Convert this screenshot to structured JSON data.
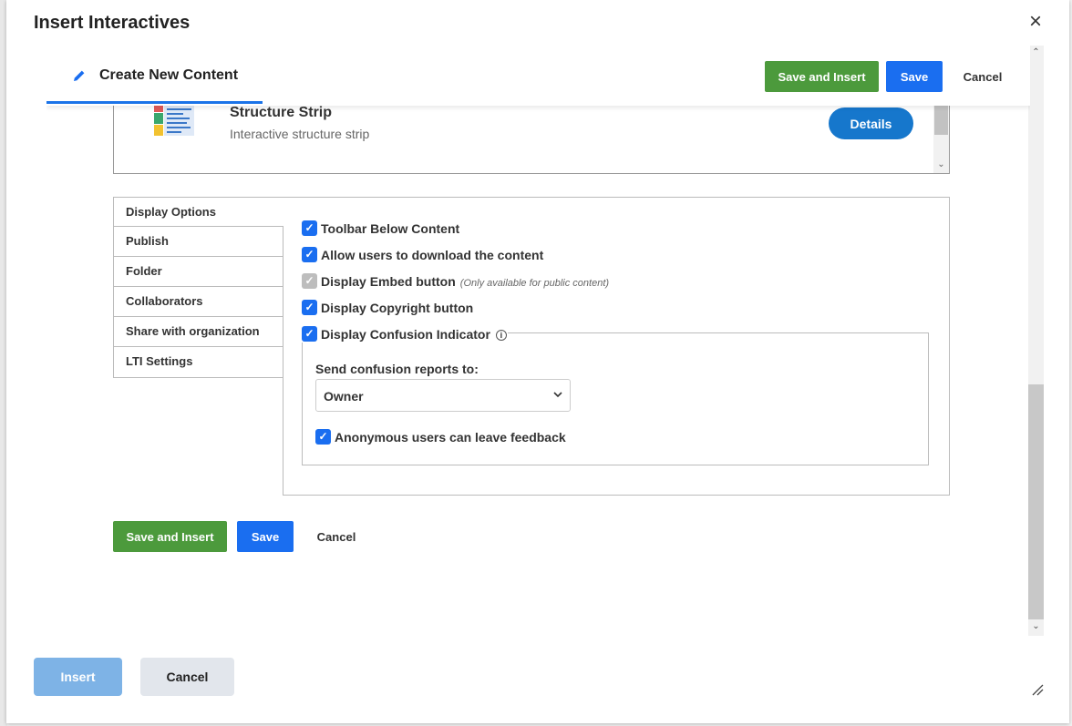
{
  "dialog": {
    "title": "Insert Interactives"
  },
  "topbar": {
    "tab_label": "Create New Content",
    "save_insert_label": "Save and Insert",
    "save_label": "Save",
    "cancel_label": "Cancel"
  },
  "item": {
    "title": "Structure Strip",
    "subtitle": "Interactive structure strip",
    "details_label": "Details"
  },
  "side_tabs": [
    "Display Options",
    "Publish",
    "Folder",
    "Collaborators",
    "Share with organization",
    "LTI Settings"
  ],
  "options": {
    "toolbar_below": {
      "label": "Toolbar Below Content",
      "checked": true
    },
    "allow_download": {
      "label": "Allow users to download the content",
      "checked": true
    },
    "embed_button": {
      "label": "Display Embed button",
      "note": "(Only available for public content)",
      "checked": true,
      "disabled": true
    },
    "copyright_button": {
      "label": "Display Copyright button",
      "checked": true
    },
    "confusion_indicator": {
      "label": "Display Confusion Indicator",
      "checked": true
    },
    "send_reports_label": "Send confusion reports to:",
    "send_reports_value": "Owner",
    "anonymous_feedback": {
      "label": "Anonymous users can leave feedback",
      "checked": true
    }
  },
  "bottom_actions": {
    "save_insert_label": "Save and Insert",
    "save_label": "Save",
    "cancel_label": "Cancel"
  },
  "footer": {
    "insert_label": "Insert",
    "cancel_label": "Cancel"
  },
  "colors": {
    "accent_blue": "#1a6ef0",
    "green": "#4c9a3c",
    "details_blue": "#1677cc",
    "insert_disabled": "#7eb3e6"
  },
  "icons": {
    "close": "close-icon",
    "tab": "pencil-icon",
    "item": "structure-strip-icon",
    "info": "info-icon",
    "select": "chevron-down-icon",
    "resize": "resize-grip-icon"
  }
}
